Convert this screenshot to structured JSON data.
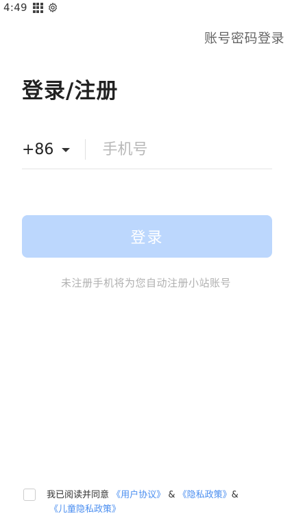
{
  "status_bar": {
    "time": "4:49"
  },
  "header": {
    "account_login_label": "账号密码登录"
  },
  "page_title": "登录/注册",
  "phone": {
    "country_code": "+86",
    "placeholder": "手机号",
    "value": ""
  },
  "login_button": {
    "label": "登录"
  },
  "hint": "未注册手机将为您自动注册小站账号",
  "agreement": {
    "prefix": "我已阅读并同意",
    "user_agreement": "《用户协议》",
    "amp1": "&",
    "privacy_policy": "《隐私政策》",
    "amp2": "&",
    "children_privacy": "《儿童隐私政策》",
    "checked": false
  },
  "colors": {
    "primary_light": "#bcd7fd",
    "link": "#4a8ef0"
  }
}
